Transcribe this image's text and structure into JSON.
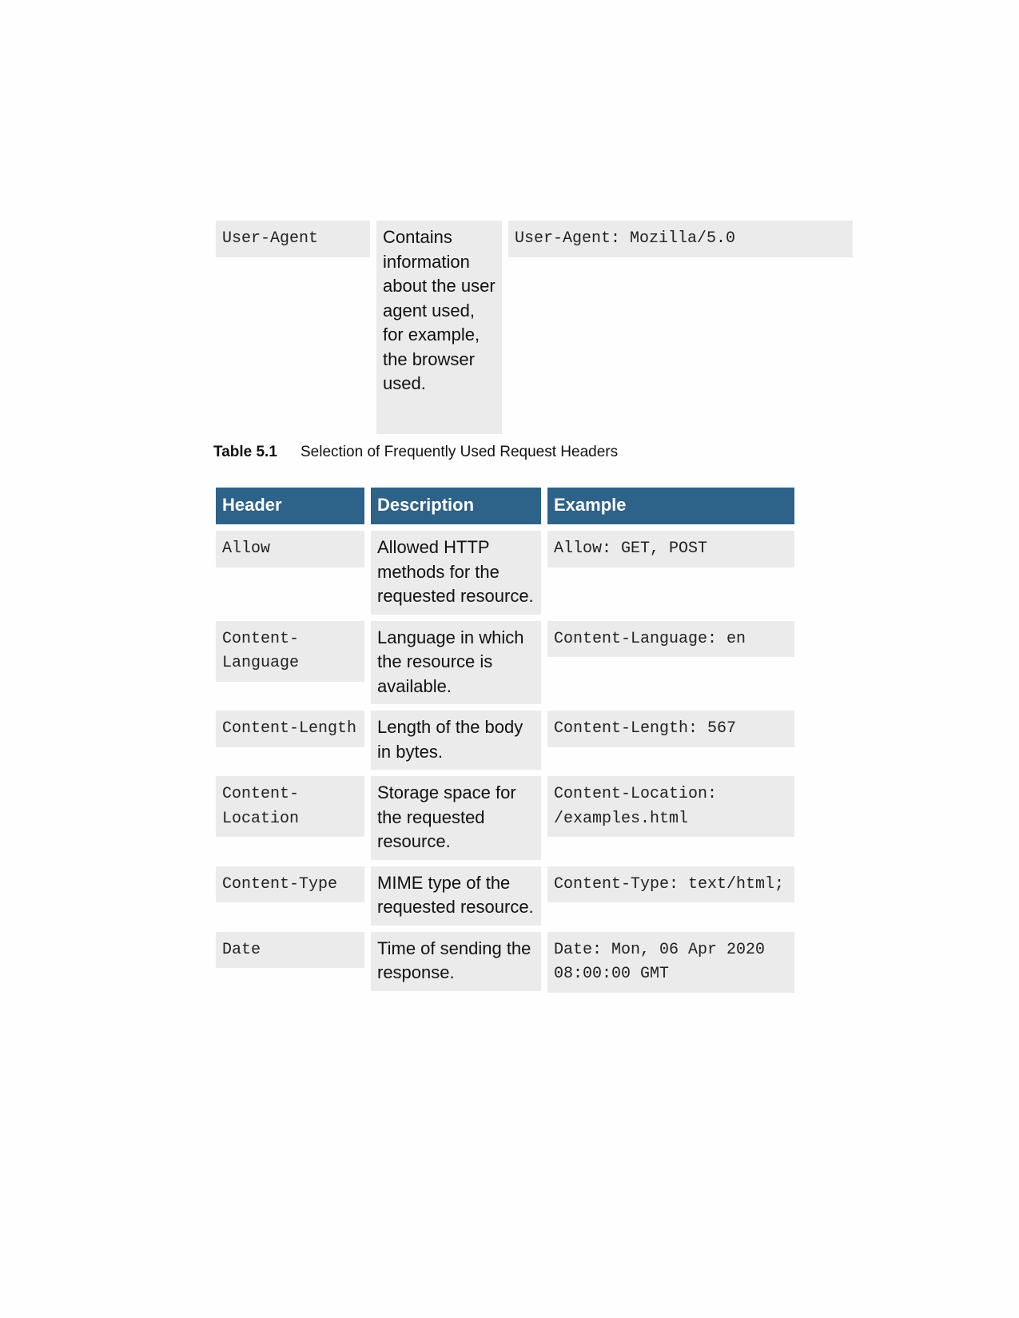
{
  "continuation_row": {
    "header": "User-Agent",
    "description": "Contains information about the user agent used, for example, the browser used.",
    "example": "User-Agent: Mozilla/5.0"
  },
  "caption": {
    "label": "Table 5.1",
    "text": "Selection of Frequently Used Request Headers"
  },
  "table": {
    "columns": [
      "Header",
      "Description",
      "Example"
    ],
    "rows": [
      {
        "header": "Allow",
        "description": "Allowed HTTP methods for the requested resource.",
        "example": "Allow: GET, POST"
      },
      {
        "header": "Content-Language",
        "description": "Language in which the resource is available.",
        "example": "Content-Language: en"
      },
      {
        "header": "Content-Length",
        "description": "Length of the body in bytes.",
        "example": "Content-Length: 567"
      },
      {
        "header": "Content-Location",
        "description": "Storage space for the requested resource.",
        "example": "Content-Location: /examples.html"
      },
      {
        "header": "Content-Type",
        "description": "MIME type of the requested resource.",
        "example": "Content-Type: text/html;"
      },
      {
        "header": "Date",
        "description": "Time of sending the response.",
        "example": "Date: Mon, 06 Apr 2020 08:00:00 GMT"
      }
    ]
  }
}
